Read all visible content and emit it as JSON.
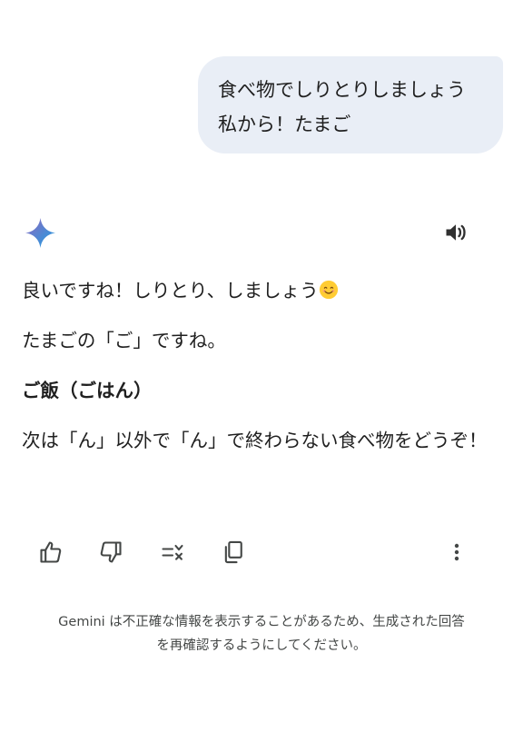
{
  "user_message": {
    "lines": [
      "食べ物でしりとりしましょう",
      "私から！たまご"
    ]
  },
  "response": {
    "icons": {
      "assistant": "gemini-sparkle-icon",
      "speaker": "speaker-icon",
      "emoji": "smiling-face-icon"
    },
    "line1": "良いですね！しりとり、しましょう",
    "line2": "たまごの「ご」ですね。",
    "line3": "ご飯（ごはん）",
    "line4": "次は「ん」以外で「ん」で終わらない食べ物をどうぞ！"
  },
  "actions": [
    {
      "name": "thumbs-up-icon"
    },
    {
      "name": "thumbs-down-icon"
    },
    {
      "name": "modify-response-icon"
    },
    {
      "name": "copy-icon"
    },
    {
      "name": "more-options-icon"
    }
  ],
  "colors": {
    "user_bubble_bg": "#e9eef6",
    "text": "#1f1f1f",
    "icon": "#444746",
    "gemini_blue": "#4285f4"
  },
  "disclaimer": {
    "line1": "Gemini は不正確な情報を表示することがあるため、生成された回答",
    "line2": "を再確認するようにしてください。"
  }
}
